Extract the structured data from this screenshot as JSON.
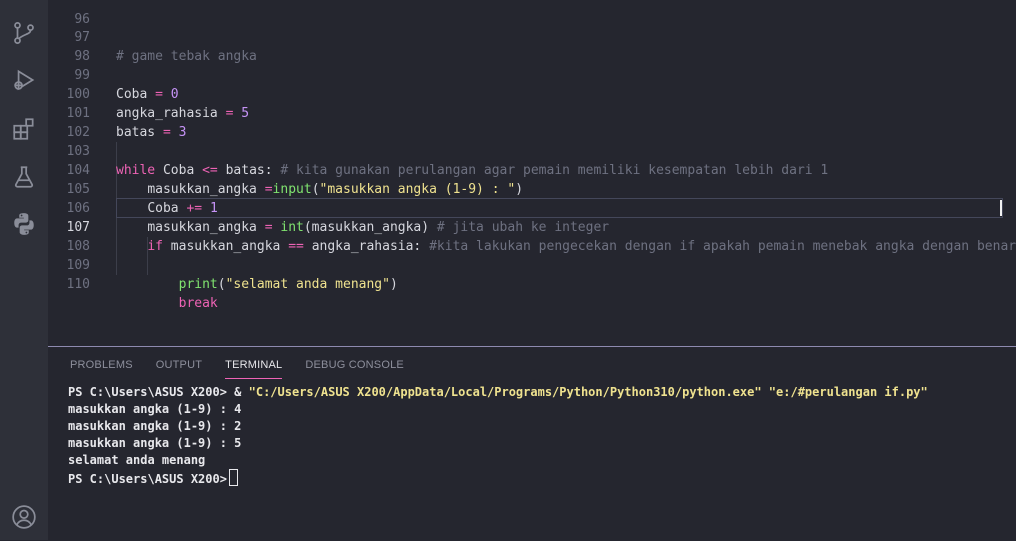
{
  "activity_bar": {
    "icons": [
      "source-control-icon",
      "run-debug-icon",
      "extensions-icon",
      "testing-icon",
      "python-icon",
      "account-icon"
    ]
  },
  "editor": {
    "top_line_number": "96",
    "lines": [
      {
        "n": "97",
        "comment": "# game tebak angka"
      },
      {
        "n": "98"
      },
      {
        "n": "99",
        "var": "Coba",
        "op": "=",
        "num": "0"
      },
      {
        "n": "100",
        "var": "angka_rahasia",
        "op": "=",
        "num": "5"
      },
      {
        "n": "101",
        "var": "batas",
        "op": "=",
        "num": "3"
      },
      {
        "n": "102"
      },
      {
        "n": "103",
        "kw": "while",
        "a": "Coba",
        "op": "<=",
        "b": "batas:",
        "comment": "# kita gunakan perulangan agar pemain memiliki kesempatan lebih dari 1"
      },
      {
        "n": "104",
        "var": "masukkan_angka",
        "op": "=",
        "fn": "input",
        "p_open": "(",
        "str": "\"masukkan angka (1-9) : \"",
        "p_close": ")"
      },
      {
        "n": "105",
        "var": "Coba",
        "op": "+=",
        "num": "1"
      },
      {
        "n": "106",
        "var": "masukkan_angka",
        "op": "=",
        "fn": "int",
        "args": "(masukkan_angka)",
        "comment": "# jita ubah ke integer"
      },
      {
        "n": "107",
        "kw": "if",
        "a": "masukkan_angka",
        "op": "==",
        "b": "angka_rahasia:",
        "comment": "#kita lakukan pengecekan dengan if apakah pemain menebak angka dengan benar"
      },
      {
        "n": "108"
      },
      {
        "n": "109",
        "fn": "print",
        "p_open": "(",
        "str": "\"selamat anda menang\"",
        "p_close": ")"
      },
      {
        "n": "110",
        "kw": "break"
      }
    ]
  },
  "panel": {
    "tabs": [
      "PROBLEMS",
      "OUTPUT",
      "TERMINAL",
      "DEBUG CONSOLE"
    ],
    "active_tab": "TERMINAL",
    "terminal": {
      "line1_prompt": "PS C:\\Users\\ASUS X200> & ",
      "line1_cmd": "\"C:/Users/ASUS X200/AppData/Local/Programs/Python/Python310/python.exe\" \"e:/#perulangan if.py\"",
      "lines": [
        "masukkan angka (1-9) : 4",
        "masukkan angka (1-9) : 2",
        "masukkan angka (1-9) : 5",
        "selamat anda menang"
      ],
      "final_prompt": "PS C:\\Users\\ASUS X200>"
    }
  },
  "colors": {
    "background": "#25262f",
    "activity_bar": "#2e3039",
    "keyword": "#ee63b5",
    "number": "#c693f6",
    "function": "#80e36f",
    "string": "#efe28f",
    "comment": "#6e7181"
  }
}
